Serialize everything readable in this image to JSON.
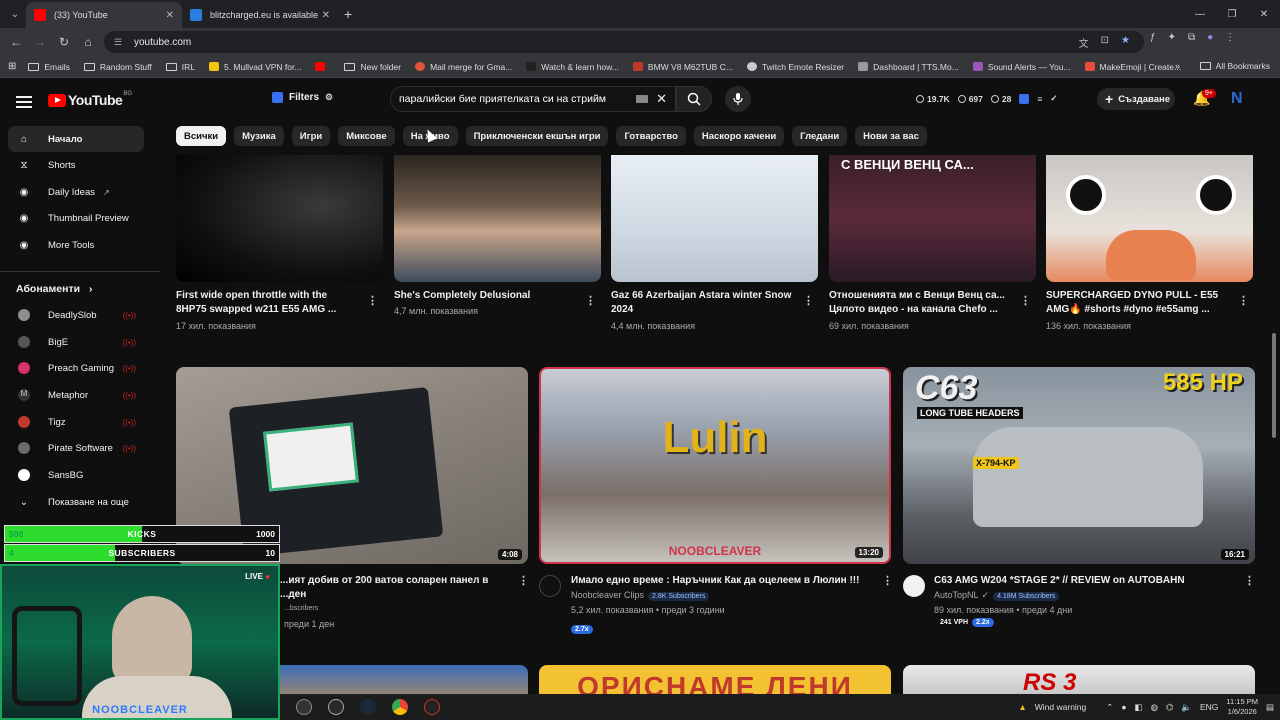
{
  "browser": {
    "tabs": [
      {
        "title": "(33) YouTube",
        "active": true,
        "favicon_color": "#ff0000"
      },
      {
        "title": "blitzcharged.eu is available for ...",
        "active": false,
        "favicon_color": "#2a7de1"
      }
    ],
    "new_tab": "+",
    "url": "youtube.com",
    "bookmarks": [
      {
        "label": "Emails",
        "type": "folder"
      },
      {
        "label": "Random Stuff",
        "type": "folder"
      },
      {
        "label": "IRL",
        "type": "folder"
      },
      {
        "label": "5. Mullvad VPN for...",
        "type": "site",
        "color": "#f1c40f"
      },
      {
        "label": "",
        "type": "site",
        "color": "#ff0000"
      },
      {
        "label": "New folder",
        "type": "folder"
      },
      {
        "label": "Mail merge for Gma...",
        "type": "site",
        "color": "#e2553a"
      },
      {
        "label": "Watch & learn how...",
        "type": "site",
        "color": "#222222"
      },
      {
        "label": "BMW V8 M62TUB C...",
        "type": "site",
        "color": "#c0392b"
      },
      {
        "label": "Twitch Emote Resizer",
        "type": "site",
        "color": "#cccccc"
      },
      {
        "label": "Dashboard | TTS.Mo...",
        "type": "site",
        "color": "#999999"
      },
      {
        "label": "Sound Alerts — You...",
        "type": "site",
        "color": "#9b59b6"
      },
      {
        "label": "MakeEmoji | Create...",
        "type": "site",
        "color": "#e74c3c"
      }
    ],
    "all_bookmarks": "All Bookmarks"
  },
  "youtube": {
    "logo_text": "YouTube",
    "country_code": "BG",
    "filters_label": "Filters",
    "search_query": "паралийски бие приятелката си на стрийм",
    "stats": {
      "views": "19.7K",
      "likes": "697",
      "count": "28"
    },
    "create_label": "Създаване",
    "notif_badge": "9+",
    "avatar_letter": "N"
  },
  "chips": [
    "Всички",
    "Музика",
    "Игри",
    "Миксове",
    "На живо",
    "Приключенски екшън игри",
    "Готварство",
    "Наскоро качени",
    "Гледани",
    "Нови за вас"
  ],
  "sidebar": {
    "items": [
      {
        "label": "Начало",
        "icon": "home-icon"
      },
      {
        "label": "Shorts",
        "icon": "shorts-icon"
      },
      {
        "label": "Daily Ideas",
        "icon": "ideas-icon"
      },
      {
        "label": "Thumbnail Preview",
        "icon": "thumbnail-icon"
      },
      {
        "label": "More Tools",
        "icon": "tools-icon"
      }
    ],
    "subs_heading": "Абонаменти",
    "subscriptions": [
      {
        "name": "DeadlySlob",
        "color": "#8e8e8e"
      },
      {
        "name": "BigE",
        "color": "#555555"
      },
      {
        "name": "Preach Gaming",
        "color": "#d6336c"
      },
      {
        "name": "Metaphor",
        "color": "#333333"
      },
      {
        "name": "Tigz",
        "color": "#c0392b"
      },
      {
        "name": "Pirate Software",
        "color": "#6b6b6b"
      },
      {
        "name": "SansBG",
        "color": "#ffffff"
      }
    ],
    "show_more": "Показване на още"
  },
  "top_videos": [
    {
      "title": "First wide open throttle with the 8HP75 swapped w211 E55 AMG ...",
      "meta": "17 хил. показвания"
    },
    {
      "title": "She's Completely Delusional",
      "meta": "4,7 млн. показвания"
    },
    {
      "title": "Gaz 66 Azerbaijan Astara winter Snow 2024",
      "meta": "4,4 млн. показвания"
    },
    {
      "title": "Отношенията ми с Венци Венц са... Цялото видео - на канала Chefo ...",
      "meta": "69 хил. показвания",
      "thumb_text": "С ВЕНЦИ ВЕНЦ СА..."
    },
    {
      "title": "SUPERCHARGED DYNO PULL - E55 AMG🔥 #shorts #dyno #e55amg ...",
      "meta": "136 хил. показвания"
    }
  ],
  "main_videos": [
    {
      "title": "...ият добив от 200 ватов соларен панел в ...ден",
      "channel": "",
      "subs": "...bscribers",
      "meta": "преди 1 ден",
      "duration": "4:08"
    },
    {
      "title": "Имало едно време : Наръчник  Как да оцелеем в Люлин !!!",
      "channel": "Noobcleaver Clips",
      "subs": "2.8K Subscribers",
      "meta": "5,2 хил. показвания • преди 3 години",
      "badge": "2.7x",
      "duration": "13:20",
      "thumb_text": "Lulin",
      "thumb_sub": "NOOBCLEAVER"
    },
    {
      "title": "C63 AMG W204 *STAGE 2* // REVIEW on AUTOBAHN",
      "channel": "AutoTopNL",
      "subs": "4.18M Subscribers",
      "meta": "89 хил. показвания • преди 4 дни",
      "vph": "241 VPH",
      "badge": "2.2x",
      "duration": "16:21",
      "thumb_text": "C63",
      "thumb_hp": "585 HP",
      "thumb_sub": "LONG TUBE HEADERS",
      "plate": "X-794-KP"
    }
  ],
  "bottom_videos": [
    {
      "thumb_text": ""
    },
    {
      "thumb_text": "ОРИСНАМЕ ЛЕНИ"
    },
    {
      "thumb_text": "RS 3"
    }
  ],
  "overlay": {
    "kicks": {
      "current": "500",
      "label": "KICKS",
      "goal": "1000",
      "progress": 0.5
    },
    "subs": {
      "current": "4",
      "label": "SUBSCRIBERS",
      "goal": "10",
      "progress": 0.4
    },
    "live_label": "LIVE",
    "streamer": "NOOBCLEAVER"
  },
  "taskbar": {
    "weather": "Wind warning",
    "lang": "ENG",
    "time": "11:15 PM",
    "date": "1/6/2026"
  }
}
